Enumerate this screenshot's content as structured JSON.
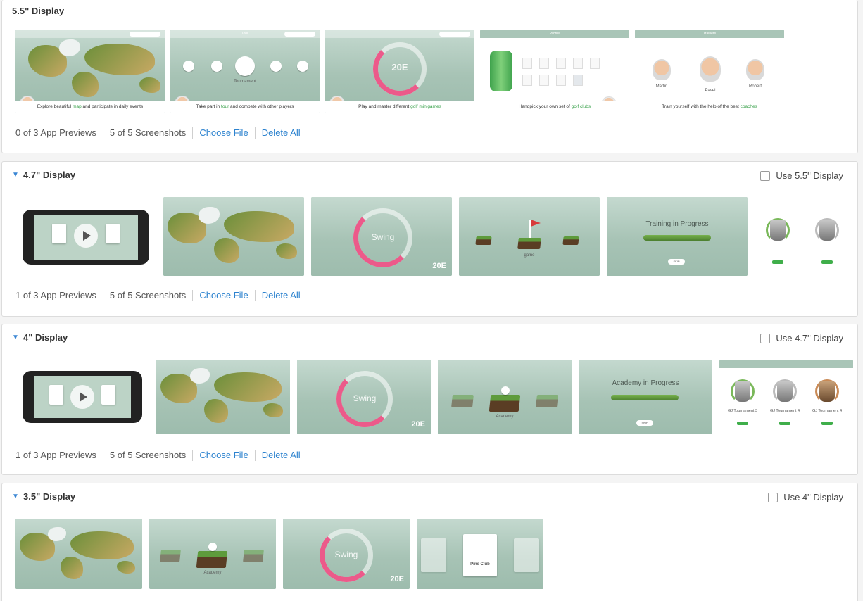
{
  "sections": {
    "s55": {
      "title": "5.5\" Display",
      "captions": {
        "map_pre": "Explore beautiful ",
        "map_hl": "map",
        "map_post": " and participate in daily events",
        "tour_pre": "Take part in ",
        "tour_hl": "tour",
        "tour_post": " and compete with other players",
        "mini_pre": "Play and master different ",
        "mini_hl": "golf minigames",
        "clubs_pre": "Handpick your own set of ",
        "clubs_hl": "golf clubs",
        "coach_pre": "Train yourself with the help of the best ",
        "coach_hl": "coaches"
      },
      "mini_labels": {
        "profile_title": "Profile",
        "trainers_title": "Trainers",
        "tour_title": "Tour",
        "tournament": "Tournament",
        "martin": "Martin",
        "pavel": "Pavel",
        "robert": "Robert"
      },
      "footer": {
        "previews": "0 of 3 App Previews",
        "screenshots": "5 of 5 Screenshots",
        "choose": "Choose File",
        "delete": "Delete All"
      }
    },
    "s47": {
      "title": "4.7\" Display",
      "use_label": "Use 5.5\" Display",
      "thumb_text": {
        "swing": "Swing",
        "score": "20E",
        "training": "Training in Progress",
        "game": "game",
        "skip": "SKIP"
      },
      "footer": {
        "previews": "1 of 3 App Previews",
        "screenshots": "5 of 5 Screenshots",
        "choose": "Choose File",
        "delete": "Delete All"
      }
    },
    "s4": {
      "title": "4\" Display",
      "use_label": "Use 4.7\" Display",
      "thumb_text": {
        "swing": "Swing",
        "score": "20E",
        "academy_progress": "Academy in Progress",
        "academy": "Academy",
        "skip": "SKIP",
        "gj3": "GJ Tournament 3",
        "gj4": "GJ Tournament 4",
        "gj5": "GJ Tournament 4"
      },
      "footer": {
        "previews": "1 of 3 App Previews",
        "screenshots": "5 of 5 Screenshots",
        "choose": "Choose File",
        "delete": "Delete All"
      }
    },
    "s35": {
      "title": "3.5\" Display",
      "use_label": "Use 4\" Display",
      "thumb_text": {
        "swing": "Swing",
        "score": "20E",
        "academy": "Academy",
        "pine_club": "Pine Club"
      }
    }
  },
  "colors": {
    "link": "#2d83cf",
    "accent_green": "#38a14a",
    "swing_arc": "#ec5a8a"
  },
  "icons": {
    "chevron": "chevron-down-icon",
    "play": "play-icon"
  }
}
